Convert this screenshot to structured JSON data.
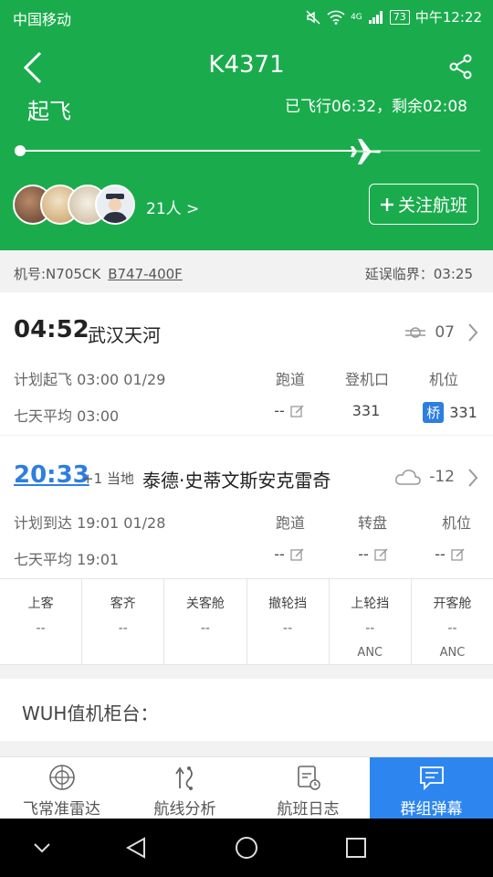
{
  "status_bar": {
    "carrier": "中国移动",
    "battery": "73",
    "time": "中午12:22",
    "network": "4G"
  },
  "header": {
    "flight_no": "K4371",
    "status": "起飞",
    "elapsed": "已飞行06:32，剩余02:08",
    "progress": 0.73,
    "follower_count": "21人 >",
    "follow_label": "关注航班"
  },
  "info": {
    "plane_no": "机号:N705CK",
    "model": "B747-400F",
    "delay": "延误临界：03:25"
  },
  "departure": {
    "time": "04:52",
    "airport": "武汉天河",
    "temp": "07",
    "plan": "计划起飞 03:00 01/29",
    "avg": "七天平均 03:00",
    "col1": "跑道",
    "col2": "登机口",
    "col3": "机位",
    "v1": "--",
    "v2": "331",
    "v3_tag": "桥",
    "v3": "331"
  },
  "arrival": {
    "time": "20:33",
    "plus": "+1 当地",
    "airport": "泰德·史蒂文斯安克雷奇",
    "temp": "-12",
    "plan": "计划到达 19:01 01/28",
    "avg": "七天平均 19:01",
    "col1": "跑道",
    "col2": "转盘",
    "col3": "机位",
    "v1": "--",
    "v2": "--",
    "v3": "--"
  },
  "milestones": [
    {
      "label": "上客",
      "value": "--",
      "sub": ""
    },
    {
      "label": "客齐",
      "value": "--",
      "sub": ""
    },
    {
      "label": "关客舱",
      "value": "--",
      "sub": ""
    },
    {
      "label": "撤轮挡",
      "value": "--",
      "sub": ""
    },
    {
      "label": "上轮挡",
      "value": "--",
      "sub": "ANC"
    },
    {
      "label": "开客舱",
      "value": "--",
      "sub": "ANC"
    }
  ],
  "checkin_label": "WUH值机柜台：",
  "tabs": [
    {
      "label": "飞常准雷达",
      "icon": "radar-icon"
    },
    {
      "label": "航线分析",
      "icon": "route-icon"
    },
    {
      "label": "航班日志",
      "icon": "log-icon"
    },
    {
      "label": "群组弹幕",
      "icon": "chat-icon"
    }
  ],
  "colors": {
    "primary_green": "#1aac4c",
    "accent_blue": "#2d86f0"
  }
}
